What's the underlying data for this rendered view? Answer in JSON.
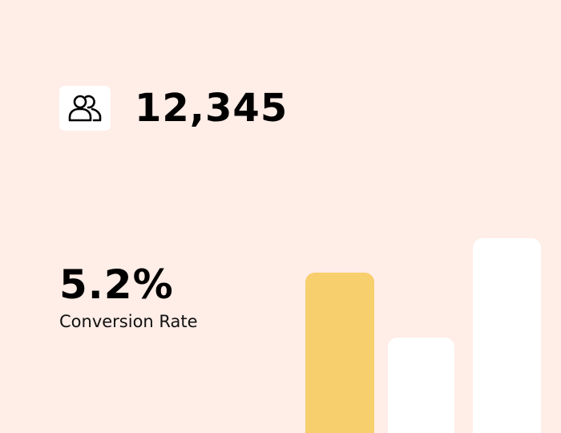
{
  "widget": {
    "users_icon": "users-icon",
    "user_count": "12,345",
    "conversion_rate": "5.2%",
    "conversion_label": "Conversion Rate"
  },
  "chart_data": {
    "type": "bar",
    "values": [
      0.74,
      0.44,
      0.9
    ],
    "colors": [
      "#F8CF6D",
      "#FFFFFF",
      "#FFFFFF"
    ]
  },
  "colors": {
    "background": "#FFEDE7",
    "accent": "#F8CF6D",
    "card": "#FFFFFF",
    "text": "#000000"
  }
}
